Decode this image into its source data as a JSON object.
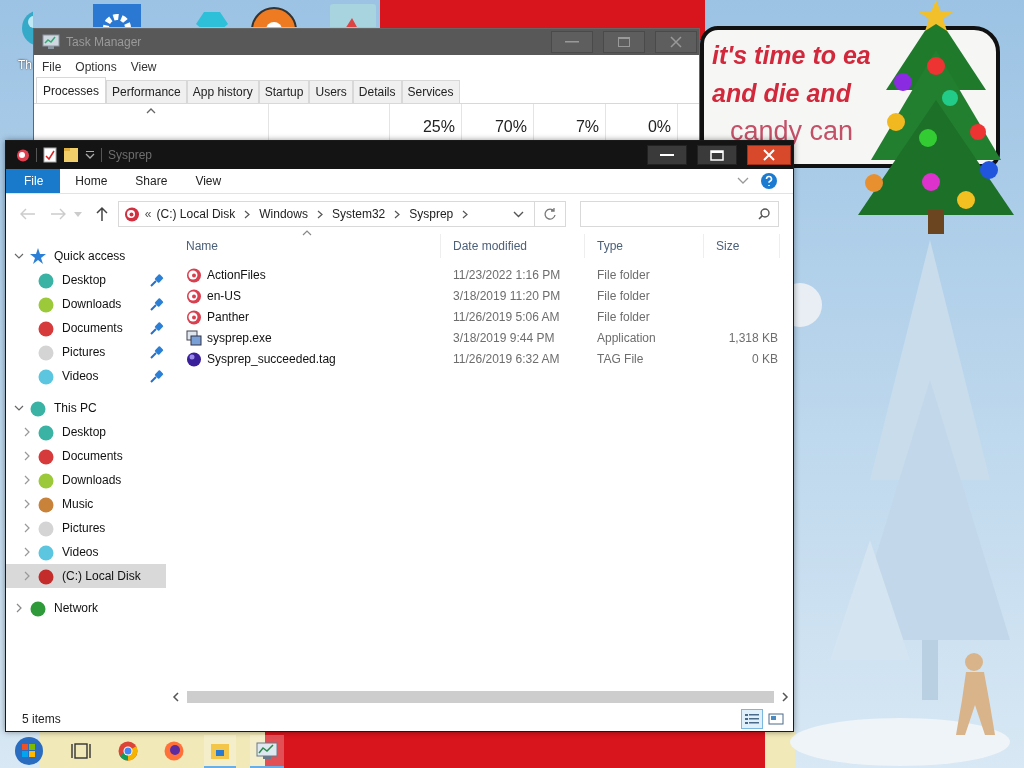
{
  "desktop": {
    "icons": [
      {
        "kind": "ball",
        "label": "Th"
      },
      {
        "kind": "gear"
      },
      {
        "kind": "gem"
      },
      {
        "kind": "disc"
      },
      {
        "kind": "photo"
      }
    ],
    "bubble_lines": [
      {
        "text": "it's time to ea",
        "kind": "bold"
      },
      {
        "text": "and die and",
        "kind": "bold"
      },
      {
        "text": "candy can",
        "kind": "plain"
      }
    ]
  },
  "task_manager": {
    "title": "Task Manager",
    "menu": [
      "File",
      "Options",
      "View"
    ],
    "tabs": [
      {
        "label": "Processes",
        "selected": true
      },
      {
        "label": "Performance",
        "selected": false
      },
      {
        "label": "App history",
        "selected": false
      },
      {
        "label": "Startup",
        "selected": false
      },
      {
        "label": "Users",
        "selected": false
      },
      {
        "label": "Details",
        "selected": false
      },
      {
        "label": "Services",
        "selected": false
      }
    ],
    "usage": [
      "25%",
      "70%",
      "7%",
      "0%"
    ]
  },
  "explorer": {
    "title": "Sysprep",
    "ribbon_tabs": [
      {
        "label": "File",
        "kind": "file"
      },
      {
        "label": "Home",
        "kind": "tab"
      },
      {
        "label": "Share",
        "kind": "tab"
      },
      {
        "label": "View",
        "kind": "tab"
      }
    ],
    "breadcrumb_overflow": "«",
    "breadcrumb": [
      "(C:) Local Disk",
      "Windows",
      "System32",
      "Sysprep"
    ],
    "navigation": [
      {
        "label": "Quick access",
        "kind": "star",
        "color": "#2b7fd6",
        "expanded": true,
        "selected": false,
        "children": [
          {
            "label": "Desktop",
            "color": "#3bb3a4",
            "pinned": true,
            "selected": false
          },
          {
            "label": "Downloads",
            "color": "#9bc93a",
            "pinned": true,
            "selected": false
          },
          {
            "label": "Documents",
            "color": "#d63a3a",
            "pinned": true,
            "selected": false
          },
          {
            "label": "Pictures",
            "color": "#d4d4d4",
            "pinned": true,
            "selected": false
          },
          {
            "label": "Videos",
            "color": "#5cc6e0",
            "pinned": true,
            "selected": false
          }
        ]
      },
      {
        "label": "This PC",
        "kind": "ball",
        "color": "#3bb3a4",
        "expanded": true,
        "selected": false,
        "children": [
          {
            "label": "Desktop",
            "color": "#3bb3a4",
            "expanded": false,
            "selected": false
          },
          {
            "label": "Documents",
            "color": "#d63a3a",
            "expanded": false,
            "selected": false
          },
          {
            "label": "Downloads",
            "color": "#9bc93a",
            "expanded": false,
            "selected": false
          },
          {
            "label": "Music",
            "color": "#c8823a",
            "expanded": false,
            "selected": false
          },
          {
            "label": "Pictures",
            "color": "#d4d4d4",
            "expanded": false,
            "selected": false
          },
          {
            "label": "Videos",
            "color": "#5cc6e0",
            "expanded": false,
            "selected": false
          },
          {
            "label": "(C:) Local Disk",
            "color": "#c42c2c",
            "expanded": false,
            "selected": true
          }
        ]
      },
      {
        "label": "Network",
        "kind": "ball",
        "color": "#2f9a3a",
        "expanded": false,
        "selected": false
      }
    ],
    "columns": [
      "Name",
      "Date modified",
      "Type",
      "Size"
    ],
    "rows": [
      {
        "name": "ActionFiles",
        "date": "11/23/2022 1:16 PM",
        "type": "File folder",
        "kind": "folder"
      },
      {
        "name": "en-US",
        "date": "3/18/2019 11:20 PM",
        "type": "File folder",
        "kind": "folder"
      },
      {
        "name": "Panther",
        "date": "11/26/2019 5:06 AM",
        "type": "File folder",
        "kind": "folder"
      },
      {
        "name": "sysprep.exe",
        "date": "3/18/2019 9:44 PM",
        "type": "Application",
        "size": "1,318 KB",
        "kind": "app"
      },
      {
        "name": "Sysprep_succeeded.tag",
        "date": "11/26/2019 6:32 AM",
        "type": "TAG File",
        "size": "0 KB",
        "kind": "tag"
      }
    ],
    "status": "5 items",
    "views": [
      {
        "kind": "details",
        "selected": true
      },
      {
        "kind": "tiles",
        "selected": false
      }
    ]
  },
  "taskbar": [
    {
      "kind": "start",
      "active": false
    },
    {
      "kind": "taskview",
      "active": false
    },
    {
      "kind": "chrome",
      "active": false
    },
    {
      "kind": "firefox",
      "active": false
    },
    {
      "kind": "explorer",
      "active": true
    },
    {
      "kind": "taskmgr",
      "active": true
    }
  ]
}
